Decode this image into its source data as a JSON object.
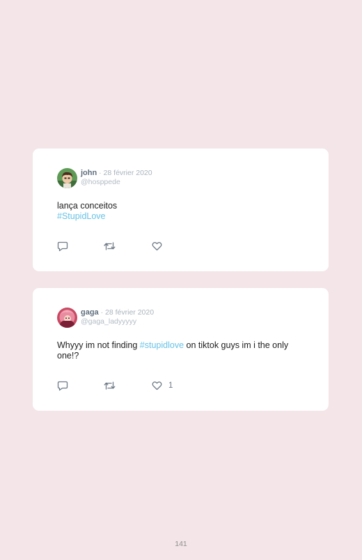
{
  "tweets": [
    {
      "name": "john",
      "date": " · 28 février 2020",
      "handle": "@hosppede",
      "text": "lança conceitos",
      "hashtag": "#StupidLove",
      "like_count": ""
    },
    {
      "name": "gaga",
      "date": " · 28 février 2020",
      "handle": "@gaga_ladyyyyy",
      "text_before": "Whyyy im not finding ",
      "hashtag": "#stupidlove",
      "text_after": " on tiktok guys im i the only one!?",
      "like_count": "1"
    }
  ],
  "icons": {
    "reply": "reply-icon",
    "retweet": "retweet-icon",
    "like": "heart-icon"
  },
  "colors": {
    "background": "#f3e5e8",
    "card": "#ffffff",
    "hashtag": "#68c2e6",
    "icon": "#6f7b87"
  },
  "page_number": "141"
}
